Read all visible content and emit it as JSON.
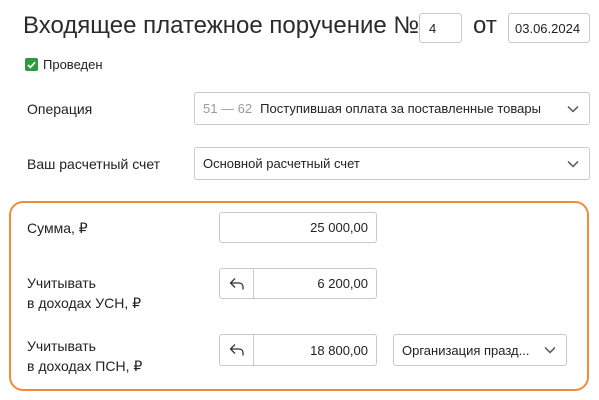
{
  "header": {
    "title": "Входящее платежное поручение №",
    "number": "4",
    "from_label": "от",
    "date": "03.06.2024"
  },
  "status": {
    "posted_label": "Проведен",
    "posted": true
  },
  "operation": {
    "label": "Операция",
    "code": "51 — 62",
    "value": "Поступившая оплата за поставленные товары"
  },
  "account": {
    "label": "Ваш расчетный счет",
    "value": "Основной расчетный счет"
  },
  "amounts": {
    "sum_label": "Сумма, ₽",
    "sum_value": "25 000,00",
    "usn_label_line1": "Учитывать",
    "usn_label_line2": "в доходах УСН, ₽",
    "usn_value": "6 200,00",
    "psn_label_line1": "Учитывать",
    "psn_label_line2": "в доходах ПСН, ₽",
    "psn_value": "18 800,00",
    "psn_activity": "Организация празд..."
  },
  "colors": {
    "highlight_border": "#ef8c3b",
    "check_green": "#2e9a3e"
  }
}
